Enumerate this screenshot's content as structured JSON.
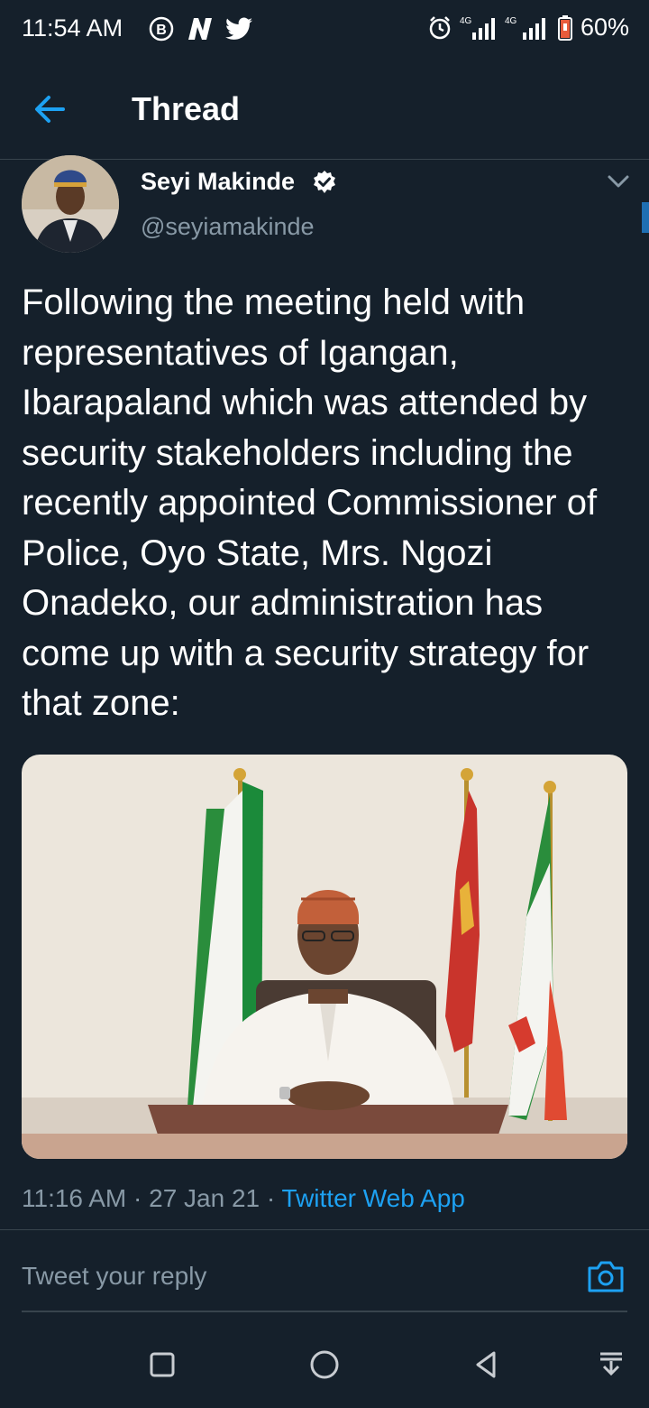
{
  "status_bar": {
    "time": "11:54 AM",
    "notification_icons": [
      "b-icon",
      "n-icon",
      "twitter-bird-icon"
    ],
    "network_1": "4G",
    "network_2": "4G",
    "battery": "60%"
  },
  "header": {
    "title": "Thread",
    "back_icon": "back-arrow-icon"
  },
  "tweet": {
    "author_name": "Seyi Makinde",
    "handle": "@seyiamakinde",
    "verified": true,
    "text": "Following the meeting held with representatives of Igangan, Ibarapaland which was attended by security stakeholders including the recently appointed Commissioner of Police, Oyo State, Mrs. Ngozi Onadeko, our administration has come up with a security strategy for that zone:",
    "time": "11:16 AM",
    "separator": "·",
    "date": "27 Jan 21",
    "source": "Twitter Web App"
  },
  "reply": {
    "placeholder": "Tweet your reply",
    "camera_icon": "camera-icon"
  },
  "colors": {
    "background": "#15202b",
    "accent": "#1da1f2",
    "secondary_text": "#8899a6",
    "divider": "#38444d"
  },
  "nav_bar": [
    "recents-square-icon",
    "home-circle-icon",
    "back-triangle-icon",
    "notification-pull-icon"
  ]
}
